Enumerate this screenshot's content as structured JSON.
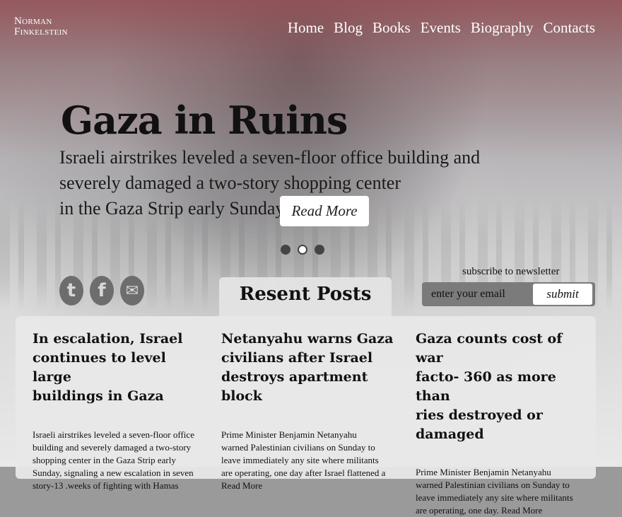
{
  "logo": {
    "line1": "Norman",
    "line2": "Finkelstein"
  },
  "nav": [
    "Home",
    "Blog",
    "Books",
    "Events",
    "Biography",
    "Contacts"
  ],
  "hero": {
    "title": "Gaza in Ruins",
    "lines": [
      "Israeli airstrikes leveled a seven-floor office building and",
      "severely damaged a two-story shopping center",
      "in the Gaza Strip early Sunday."
    ],
    "read_more": "Read More"
  },
  "carousel": {
    "count": 3,
    "active": 0
  },
  "social": [
    {
      "icon": "twitter-icon",
      "glyph": "t"
    },
    {
      "icon": "facebook-icon",
      "glyph": "f"
    },
    {
      "icon": "email-icon",
      "glyph": "✉"
    }
  ],
  "newsletter": {
    "label": "subscribe to newsletter",
    "placeholder": "enter your email",
    "submit": "submit"
  },
  "posts": {
    "heading": "Resent Posts",
    "items": [
      {
        "title_lines": [
          "In escalation, Israel",
          "continues to level large",
          "buildings in Gaza"
        ],
        "body_lines": [
          "Israeli airstrikes leveled a seven-floor office",
          "building and severely damaged a two-story",
          "shopping center in the Gaza Strip early",
          "Sunday, signaling a new escalation in seven",
          "story-13 .weeks of fighting with Hamas"
        ]
      },
      {
        "title_lines": [
          "Netanyahu warns Gaza",
          "civilians after Israel",
          "destroys apartment block"
        ],
        "body_lines": [
          "Prime Minister Benjamin Netanyahu",
          "warned Palestinian civilians on Sunday to",
          "leave immediately any site where militants",
          "are operating, one day after Israel flattened a",
          "Read More"
        ]
      },
      {
        "title_lines": [
          "Gaza counts cost of war",
          "facto- 360 as more than",
          "ries destroyed or",
          "damaged"
        ],
        "body_lines": [
          "Prime Minister Benjamin Netanyahu",
          "warned Palestinian civilians on Sunday to",
          "leave immediately any site where militants",
          "are operating, one day. Read More"
        ]
      }
    ]
  }
}
